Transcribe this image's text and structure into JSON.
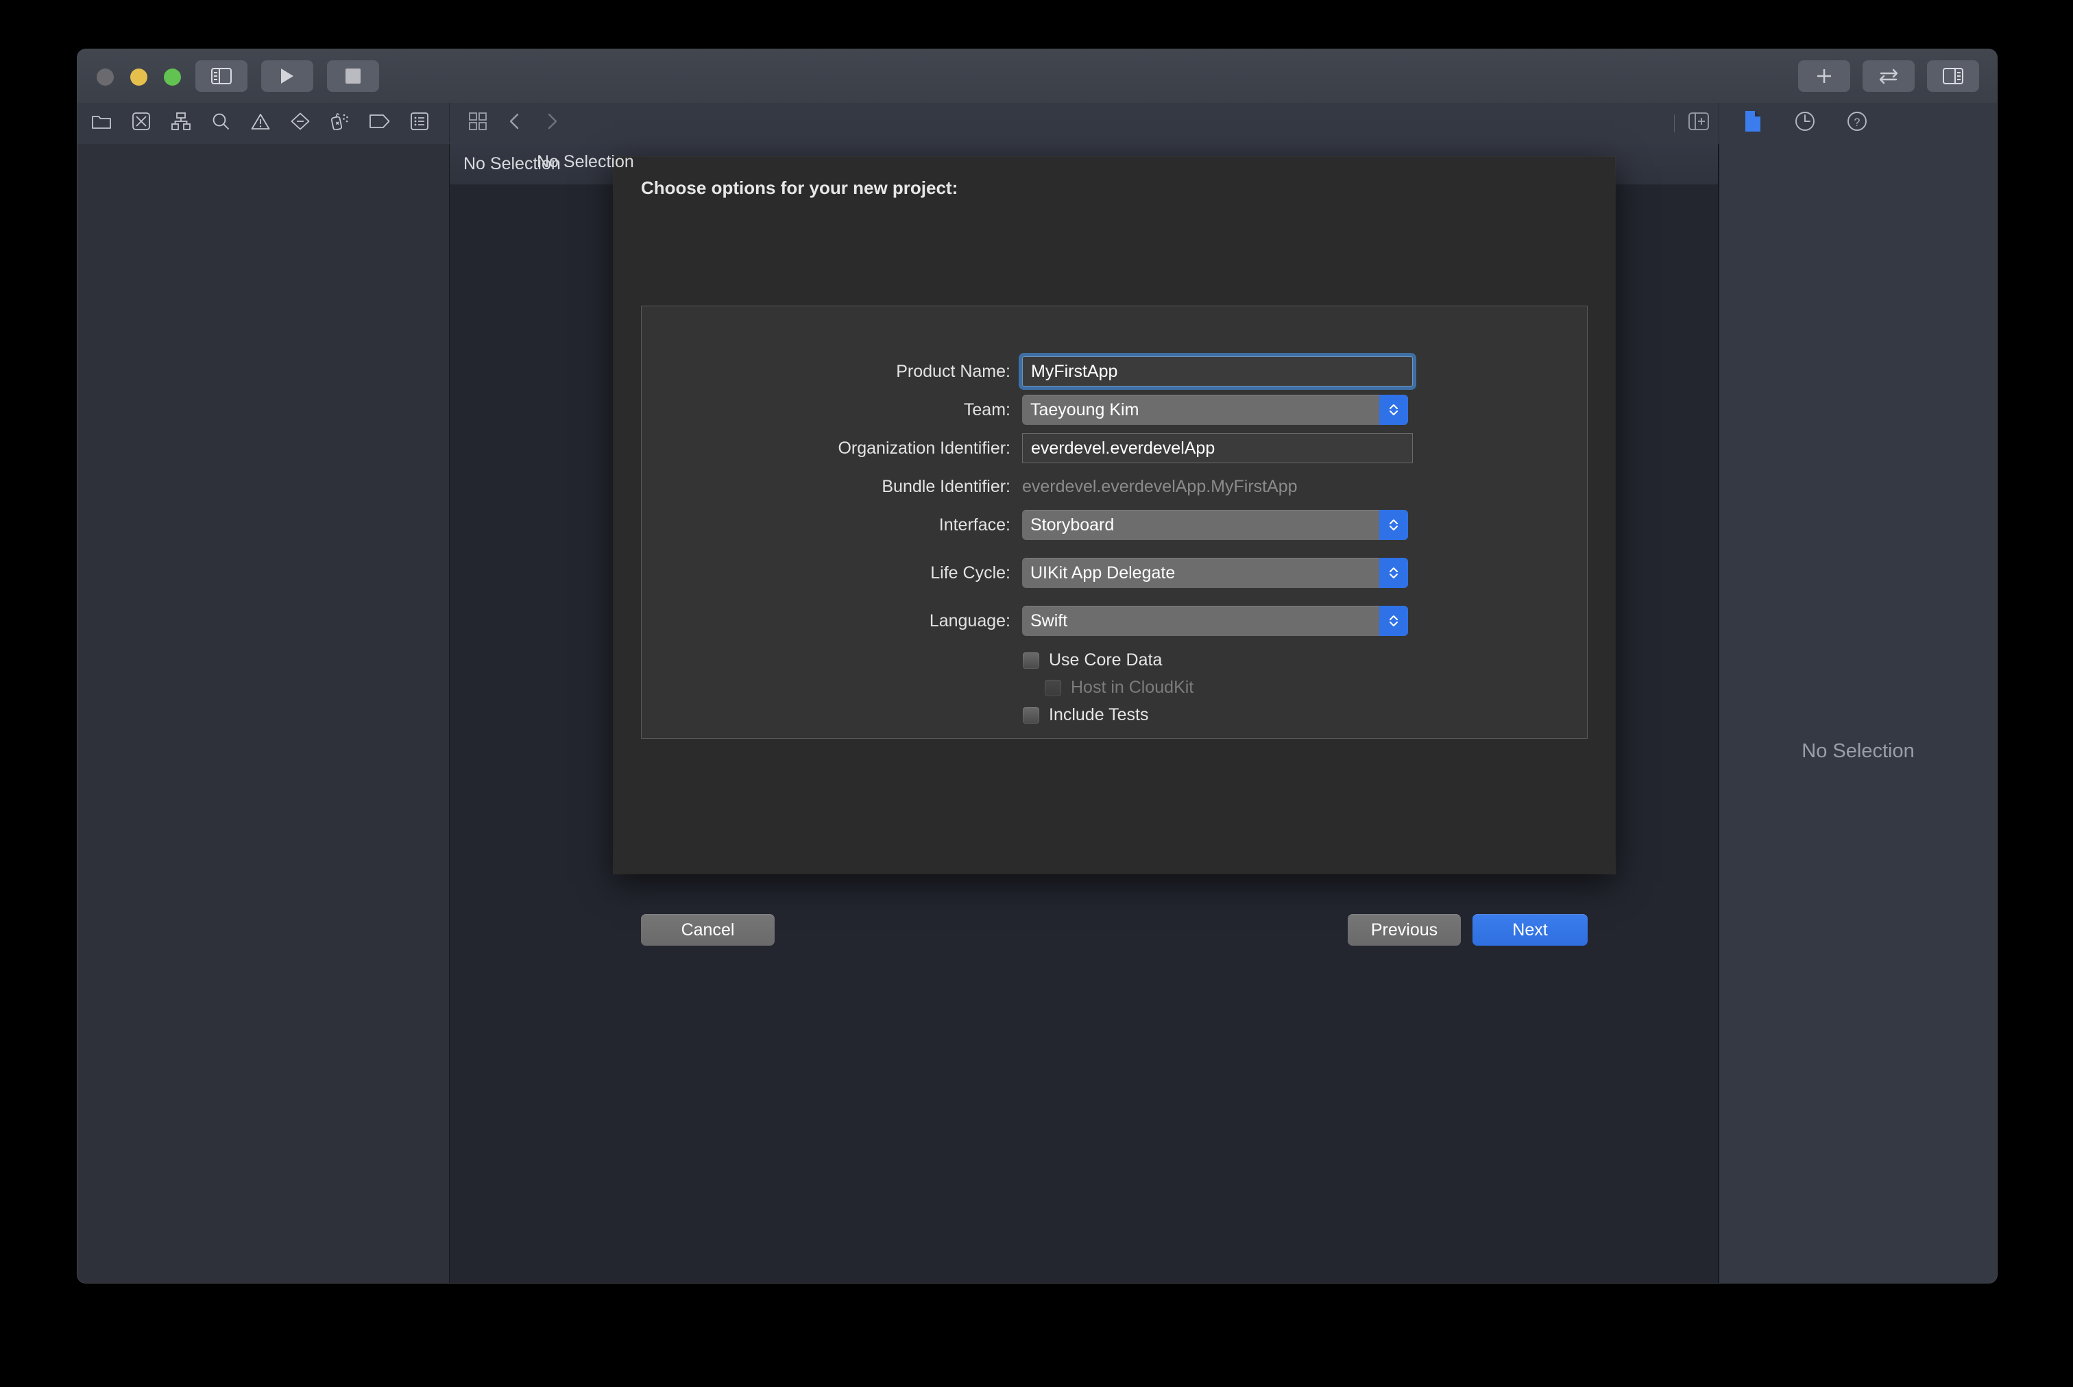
{
  "window": {
    "traffic_lights": [
      "close",
      "minimize",
      "zoom"
    ],
    "toolbar": {
      "left_buttons": [
        {
          "name": "toggle-navigator-button",
          "icon": "sidebar-left-icon"
        },
        {
          "name": "run-button",
          "icon": "play-icon"
        },
        {
          "name": "stop-button",
          "icon": "stop-icon"
        }
      ],
      "status_bar_value": "",
      "right_buttons": [
        {
          "name": "add-button",
          "icon": "plus-icon"
        },
        {
          "name": "code-review-button",
          "icon": "swap-arrows-icon"
        },
        {
          "name": "toggle-inspector-button",
          "icon": "sidebar-right-icon"
        }
      ]
    },
    "navigator_toolbar": {
      "tabs": [
        {
          "name": "project-navigator-tab",
          "icon": "folder-icon"
        },
        {
          "name": "source-control-navigator-tab",
          "icon": "source-control-icon"
        },
        {
          "name": "symbol-navigator-tab",
          "icon": "hierarchy-icon"
        },
        {
          "name": "find-navigator-tab",
          "icon": "search-icon"
        },
        {
          "name": "issue-navigator-tab",
          "icon": "warning-triangle-icon"
        },
        {
          "name": "test-navigator-tab",
          "icon": "diamond-icon"
        },
        {
          "name": "debug-navigator-tab",
          "icon": "spray-can-icon"
        },
        {
          "name": "breakpoint-navigator-tab",
          "icon": "tag-icon"
        },
        {
          "name": "report-navigator-tab",
          "icon": "report-list-icon"
        }
      ]
    },
    "jump_bar": {
      "related_items_icon": "grid-icon",
      "back_icon": "chevron-left-icon",
      "forward_icon": "chevron-right-icon",
      "add_editor_icon": "add-editor-icon"
    },
    "inspector_tabs": [
      {
        "name": "file-inspector-tab",
        "icon": "document-icon",
        "selected": true
      },
      {
        "name": "history-inspector-tab",
        "icon": "clock-icon",
        "selected": false
      },
      {
        "name": "quick-help-inspector-tab",
        "icon": "question-mark-icon",
        "selected": false
      }
    ],
    "navigator_header_text": "No Selection",
    "editor_placeholder": "No Selection",
    "inspector_placeholder": "No Selection"
  },
  "dialog": {
    "title": "Choose options for your new project:",
    "fields": [
      {
        "name": "product-name",
        "label": "Product Name:",
        "type": "textfield",
        "value": "MyFirstApp",
        "focused": true
      },
      {
        "name": "team",
        "label": "Team:",
        "type": "popup",
        "value": "Taeyoung Kim"
      },
      {
        "name": "organization-identifier",
        "label": "Organization Identifier:",
        "type": "textfield",
        "value": "everdevel.everdevelApp",
        "focused": false
      },
      {
        "name": "bundle-identifier",
        "label": "Bundle Identifier:",
        "type": "static",
        "value": "everdevel.everdevelApp.MyFirstApp"
      },
      {
        "name": "interface",
        "label": "Interface:",
        "type": "popup",
        "value": "Storyboard"
      },
      {
        "name": "life-cycle",
        "label": "Life Cycle:",
        "type": "popup",
        "value": "UIKit App Delegate"
      },
      {
        "name": "language",
        "label": "Language:",
        "type": "popup",
        "value": "Swift"
      }
    ],
    "checkboxes": [
      {
        "name": "use-core-data",
        "label": "Use Core Data",
        "checked": false,
        "disabled": false,
        "indent": 0
      },
      {
        "name": "host-in-cloudkit",
        "label": "Host in CloudKit",
        "checked": false,
        "disabled": true,
        "indent": 1
      },
      {
        "name": "include-tests",
        "label": "Include Tests",
        "checked": false,
        "disabled": false,
        "indent": 0
      }
    ],
    "buttons": {
      "cancel": "Cancel",
      "previous": "Previous",
      "next": "Next"
    }
  },
  "colors": {
    "accent_blue": "#2f6fe0",
    "focus_ring": "#3e73ac",
    "window_chrome": "#353944",
    "navigator_bg": "#2e3139",
    "editor_bg": "#23262f",
    "sheet_bg": "#2b2b2b",
    "sheet_body_bg": "#343434"
  }
}
